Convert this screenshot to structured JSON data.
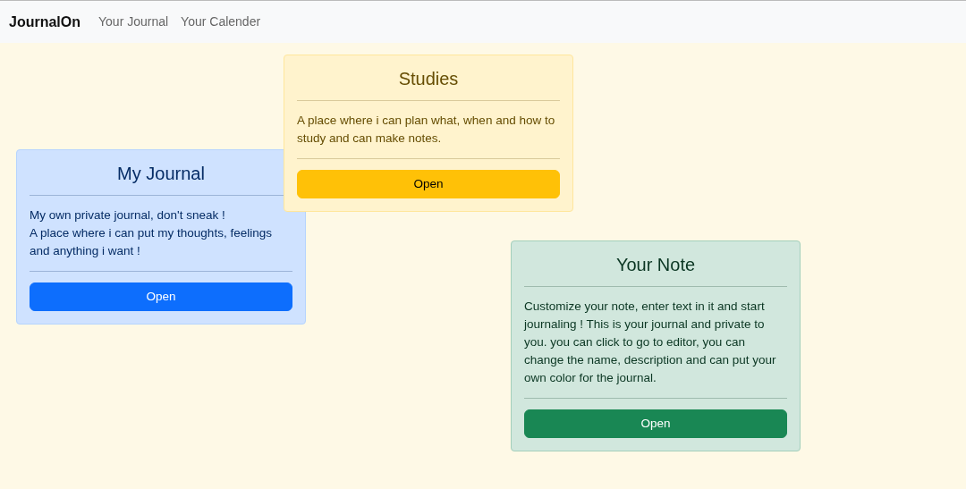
{
  "navbar": {
    "brand": "JournalOn",
    "links": [
      "Your Journal",
      "Your Calender"
    ]
  },
  "cards": [
    {
      "kind": "primary",
      "title": "My Journal",
      "text": "My own private journal, don't sneak !\nA place where i can put my thoughts, feelings and anything i want !",
      "button": "Open"
    },
    {
      "kind": "warning",
      "title": "Studies",
      "text": "A place where i can plan what, when and how to study and can make notes.",
      "button": "Open"
    },
    {
      "kind": "success",
      "title": "Your Note",
      "text": "Customize your note, enter text in it and start journaling ! This is your journal and private to you. you can click to go to editor, you can change the name, description and can put your own color for the journal.",
      "button": "Open"
    }
  ]
}
